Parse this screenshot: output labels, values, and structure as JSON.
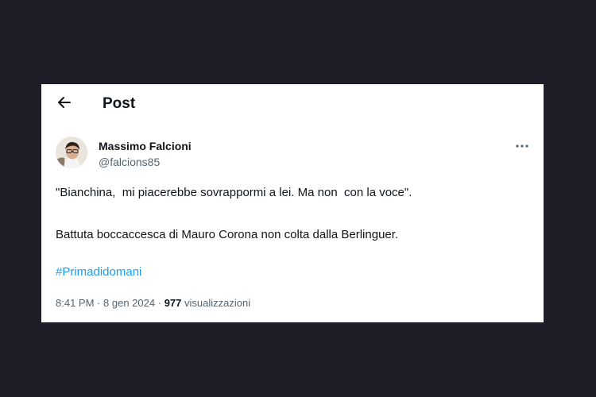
{
  "header": {
    "title": "Post",
    "back_icon": "arrow-left-icon"
  },
  "author": {
    "name": "Massimo Falcioni",
    "handle": "@falcions85",
    "avatar": "profile-photo"
  },
  "post": {
    "line1": "\"Bianchina,  mi piacerebbe sovrappormi a lei. Ma non  con la voce\".",
    "line2": "Battuta boccaccesca di Mauro Corona non colta dalla Berlinguer.",
    "hashtag": "#Primadidomani"
  },
  "meta": {
    "time": "8:41 PM",
    "separator": "·",
    "date": "8 gen 2024",
    "views_count": "977",
    "views_label": "visualizzazioni"
  },
  "more_icon": "more-dots-icon",
  "colors": {
    "background": "#1d1e27",
    "card": "#ffffff",
    "text": "#0f1419",
    "secondary": "#536471",
    "link": "#1d9bf0"
  }
}
